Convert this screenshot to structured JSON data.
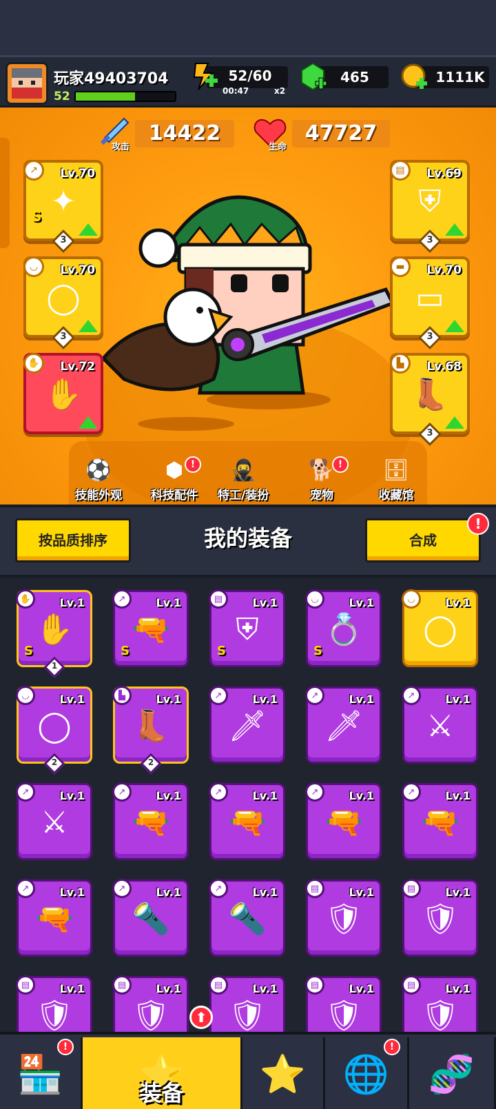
{
  "player": {
    "name": "玩家49403704",
    "level": "52",
    "xp_fraction": 0.6,
    "avatar_icon": "ninja-avatar"
  },
  "resources": {
    "energy": {
      "value": "52/60",
      "timer": "00:47",
      "multiplier": "x2",
      "icon": "energy-icon"
    },
    "gems": {
      "value": "465",
      "icon": "gem-icon"
    },
    "coins": {
      "value": "1111K",
      "icon": "coin-icon"
    }
  },
  "stats": {
    "attack": {
      "label": "攻击",
      "value": "14422",
      "icon": "sword-icon"
    },
    "hp": {
      "label": "生命",
      "value": "47727",
      "icon": "heart-icon"
    }
  },
  "equipped": {
    "left": [
      {
        "type": "weapon",
        "level": "Lv.70",
        "stars": "3",
        "rank": "S",
        "icon": "shuriken-icon",
        "bg": "#ffd21a"
      },
      {
        "type": "necklace",
        "level": "Lv.70",
        "stars": "3",
        "rank": "",
        "icon": "collar-icon",
        "bg": "#ffd21a"
      },
      {
        "type": "glove",
        "level": "Lv.72",
        "stars": "",
        "rank": "",
        "icon": "gauntlet-icon",
        "bg": "#ff4a5c"
      }
    ],
    "right": [
      {
        "type": "armor",
        "level": "Lv.69",
        "stars": "3",
        "icon": "armor-icon"
      },
      {
        "type": "belt",
        "level": "Lv.70",
        "stars": "3",
        "icon": "belt-icon"
      },
      {
        "type": "boots",
        "level": "Lv.68",
        "stars": "3",
        "icon": "boots-icon"
      }
    ]
  },
  "hero_nav": [
    {
      "label": "技能外观",
      "icon": "skill-skin-icon",
      "badge": ""
    },
    {
      "label": "科技配件",
      "icon": "tech-part-icon",
      "badge": "!"
    },
    {
      "label": "特工/装扮",
      "icon": "agent-icon",
      "badge": ""
    },
    {
      "label": "宠物",
      "icon": "pet-icon",
      "badge": "!"
    },
    {
      "label": "收藏馆",
      "icon": "collection-icon",
      "badge": ""
    }
  ],
  "inventory_bar": {
    "sort_label": "按品质排序",
    "title": "我的装备",
    "merge_label": "合成",
    "merge_badge": "!"
  },
  "inventory": [
    {
      "level": "Lv.1",
      "type": "glove",
      "icon": "gauntlet-icon",
      "rank": "S",
      "stars": "1",
      "style": "purple-gold"
    },
    {
      "level": "Lv.1",
      "type": "weapon",
      "icon": "blaster-icon",
      "rank": "S",
      "stars": "",
      "style": "purple"
    },
    {
      "level": "Lv.1",
      "type": "armor",
      "icon": "mech-armor-icon",
      "rank": "S",
      "stars": "",
      "style": "purple"
    },
    {
      "level": "Lv.1",
      "type": "necklace",
      "icon": "ring-icon",
      "rank": "S",
      "stars": "",
      "style": "purple"
    },
    {
      "level": "Lv.1",
      "type": "necklace",
      "icon": "collar-icon",
      "rank": "",
      "stars": "",
      "style": "gold"
    },
    {
      "level": "Lv.1",
      "type": "necklace",
      "icon": "collar-icon",
      "rank": "",
      "stars": "2",
      "style": "purple-gold"
    },
    {
      "level": "Lv.1",
      "type": "boots",
      "icon": "boots-icon",
      "rank": "",
      "stars": "2",
      "style": "purple-gold"
    },
    {
      "level": "Lv.1",
      "type": "weapon",
      "icon": "kunai-icon",
      "rank": "",
      "stars": "",
      "style": "purple"
    },
    {
      "level": "Lv.1",
      "type": "weapon",
      "icon": "kunai-icon",
      "rank": "",
      "stars": "",
      "style": "purple"
    },
    {
      "level": "Lv.1",
      "type": "weapon",
      "icon": "sword-icon",
      "rank": "",
      "stars": "",
      "style": "purple"
    },
    {
      "level": "Lv.1",
      "type": "weapon",
      "icon": "sword-icon",
      "rank": "",
      "stars": "",
      "style": "purple"
    },
    {
      "level": "Lv.1",
      "type": "weapon",
      "icon": "revolver-icon",
      "rank": "",
      "stars": "",
      "style": "purple"
    },
    {
      "level": "Lv.1",
      "type": "weapon",
      "icon": "revolver-icon",
      "rank": "",
      "stars": "",
      "style": "purple"
    },
    {
      "level": "Lv.1",
      "type": "weapon",
      "icon": "revolver-icon",
      "rank": "",
      "stars": "",
      "style": "purple"
    },
    {
      "level": "Lv.1",
      "type": "weapon",
      "icon": "shotgun-icon",
      "rank": "",
      "stars": "",
      "style": "purple"
    },
    {
      "level": "Lv.1",
      "type": "weapon",
      "icon": "shotgun-icon",
      "rank": "",
      "stars": "",
      "style": "purple"
    },
    {
      "level": "Lv.1",
      "type": "weapon",
      "icon": "torch-icon",
      "rank": "",
      "stars": "",
      "style": "purple"
    },
    {
      "level": "Lv.1",
      "type": "weapon",
      "icon": "torch-icon",
      "rank": "",
      "stars": "",
      "style": "purple"
    },
    {
      "level": "Lv.1",
      "type": "armor",
      "icon": "leaf-armor-icon",
      "rank": "",
      "stars": "",
      "style": "purple"
    },
    {
      "level": "Lv.1",
      "type": "armor",
      "icon": "leaf-armor-icon",
      "rank": "",
      "stars": "",
      "style": "purple"
    },
    {
      "level": "Lv.1",
      "type": "armor",
      "icon": "chest-armor-icon",
      "rank": "",
      "stars": "",
      "style": "purple"
    },
    {
      "level": "Lv.1",
      "type": "armor",
      "icon": "chest-armor-icon",
      "rank": "",
      "stars": "",
      "style": "purple"
    },
    {
      "level": "Lv.1",
      "type": "armor",
      "icon": "chest-armor-icon",
      "rank": "",
      "stars": "",
      "style": "purple"
    },
    {
      "level": "Lv.1",
      "type": "armor",
      "icon": "chest-armor-icon",
      "rank": "",
      "stars": "",
      "style": "purple"
    },
    {
      "level": "Lv.1",
      "type": "armor",
      "icon": "chest-armor-icon",
      "rank": "",
      "stars": "",
      "style": "purple"
    }
  ],
  "bottom_nav": [
    {
      "label": "",
      "icon": "shop-icon",
      "badge": "!"
    },
    {
      "label": "装备",
      "icon": "equipment-icon",
      "badge": "⬆"
    },
    {
      "label": "",
      "icon": "star-swords-icon",
      "badge": ""
    },
    {
      "label": "",
      "icon": "planet-icon",
      "badge": "!"
    },
    {
      "label": "",
      "icon": "dna-icon",
      "badge": ""
    }
  ],
  "colors": {
    "hero_bg": "#ff9d10",
    "slot_gold": "#ffd21a",
    "slot_red": "#ff4a5c",
    "item_purple": "#b03be0",
    "accent_yellow": "#ffd800",
    "badge_red": "#ff2a3a"
  }
}
